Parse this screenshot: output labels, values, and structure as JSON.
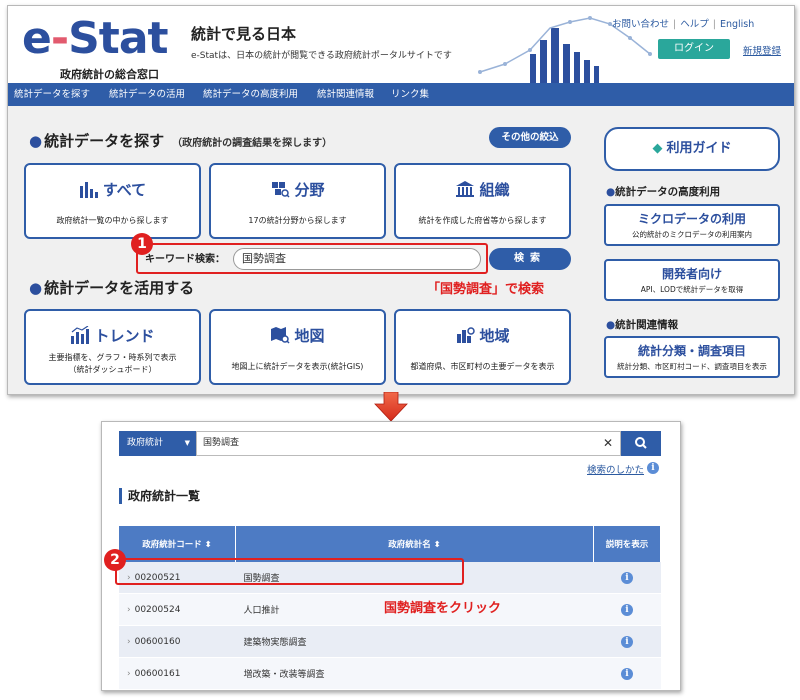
{
  "header": {
    "logo_text_e": "e",
    "logo_text_dash": "-",
    "logo_text_stat": "Stat",
    "logo_sub": "政府統計の総合窓口",
    "site_title": "統計で見る日本",
    "site_desc": "e-Statは、日本の統計が閲覧できる政府統計ポータルサイトです",
    "links": [
      "お問い合わせ",
      "ヘルプ",
      "English"
    ],
    "login_label": "ログイン",
    "register_label": "新規登録"
  },
  "nav": {
    "items": [
      "統計データを探す",
      "統計データの活用",
      "統計データの高度利用",
      "統計関連情報",
      "リンク集"
    ]
  },
  "search_section": {
    "title": "統計データを探す",
    "subtitle": "（政府統計の調査結果を探します）",
    "other_filter_label": "その他の絞込",
    "cards": [
      {
        "title": "すべて",
        "desc": "政府統計一覧の中から探します"
      },
      {
        "title": "分野",
        "desc": "17の統計分野から探します"
      },
      {
        "title": "組織",
        "desc": "統計を作成した府省等から探します"
      }
    ],
    "keyword_label": "キーワード検索：",
    "keyword_value": "国勢調査",
    "search_button": "検索"
  },
  "use_section": {
    "title": "統計データを活用する",
    "cards": [
      {
        "title": "トレンド",
        "desc": "主要指標を、グラフ・時系列で表示\n（統計ダッシュボード）"
      },
      {
        "title": "地図",
        "desc": "地図上に統計データを表示(統計GIS)"
      },
      {
        "title": "地域",
        "desc": "都道府県、市区町村の主要データを表示"
      }
    ]
  },
  "sidebar": {
    "guide_label": "利用ガイド",
    "advanced_heading": "統計データの高度利用",
    "advanced_cards": [
      {
        "title": "ミクロデータの利用",
        "desc": "公的統計のミクロデータの利用案内"
      },
      {
        "title": "開発者向け",
        "desc": "API、LODで統計データを取得"
      }
    ],
    "related_heading": "統計関連情報",
    "related_cards": [
      {
        "title": "統計分類・調査項目",
        "desc": "統計分類、市区町村コード、調査項目を表示"
      }
    ]
  },
  "annotations": {
    "step1_number": "1",
    "step1_text": "「国勢調査」で検索",
    "step2_number": "2",
    "step2_text": "国勢調査をクリック"
  },
  "results": {
    "category_label": "政府統計",
    "query_value": "国勢調査",
    "howto_label": "検索のしかた",
    "list_title": "政府統計一覧",
    "columns": [
      "政府統計コード",
      "政府統計名",
      "説明を表示"
    ],
    "rows": [
      {
        "code": "00200521",
        "name": "国勢調査"
      },
      {
        "code": "00200524",
        "name": "人口推計"
      },
      {
        "code": "00600160",
        "name": "建築物実態調査"
      },
      {
        "code": "00600161",
        "name": "増改築・改装等調査"
      }
    ]
  },
  "colors": {
    "brand_blue": "#2f5da8",
    "accent_red": "#e02020",
    "login_teal": "#2aa79b",
    "table_header": "#4d7bc4"
  }
}
